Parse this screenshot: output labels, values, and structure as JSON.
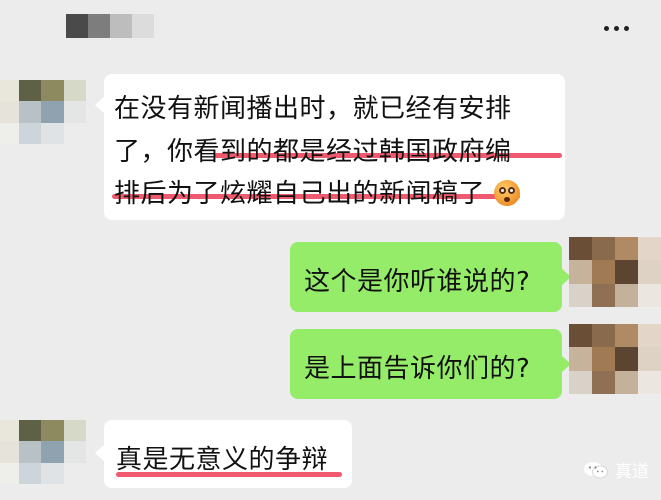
{
  "header": {
    "more_icon": "ellipsis-icon"
  },
  "messages": [
    {
      "side": "left",
      "lines": [
        "在没有新闻播出时，就已经有安排",
        "了，你看到的都是经过韩国政府编",
        "排后为了炫耀自己出的新闻稿了"
      ],
      "emoji": "flushed-face-emoji"
    },
    {
      "side": "right",
      "text": "这个是你听谁说的?"
    },
    {
      "side": "right",
      "text": "是上面告诉你们的?"
    },
    {
      "side": "left",
      "text": "真是无意义的争辩"
    }
  ],
  "watermark": {
    "text": "真道",
    "icon": "wechat-logo-icon"
  },
  "colors": {
    "background": "#ececec",
    "bubble_other": "#ffffff",
    "bubble_self": "#95ec69",
    "highlight_underline": "#f05a6e"
  }
}
